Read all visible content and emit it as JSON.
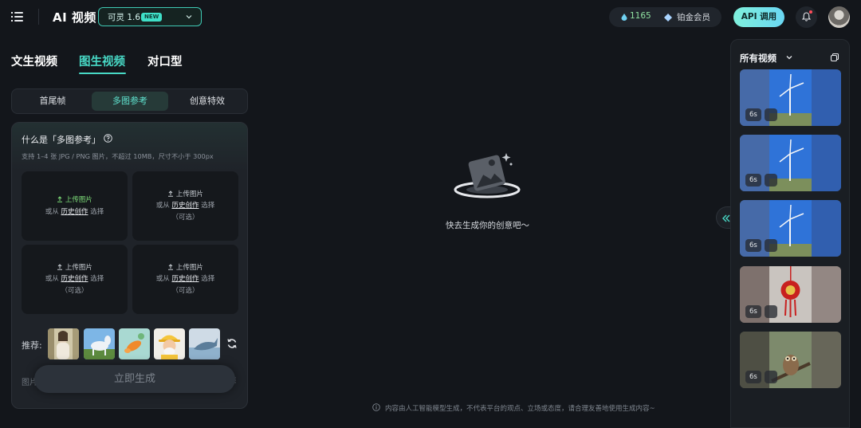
{
  "header": {
    "app_title": "AI 视频",
    "model": {
      "name": "可灵 1.6",
      "badge": "NEW"
    },
    "credits": "1165",
    "membership": "铂金会员",
    "api_label": "API 调用"
  },
  "modes": [
    "文生视频",
    "图生视频",
    "对口型"
  ],
  "active_mode": "图生视频",
  "segments": [
    "首尾帧",
    "多图参考",
    "创意特效"
  ],
  "active_segment": "多图参考",
  "card": {
    "title": "什么是「多图参考」",
    "subtitle": "支持 1–4 张 JPG / PNG 图片，不超过 10MB，尺寸不小于 300px",
    "slots": [
      {
        "upload": "上传图片",
        "or": "或从",
        "history": "历史创作",
        "select": "选择",
        "optional": ""
      },
      {
        "upload": "上传图片",
        "or": "或从",
        "history": "历史创作",
        "select": "选择",
        "optional": "（可选）"
      },
      {
        "upload": "上传图片",
        "or": "或从",
        "history": "历史创作",
        "select": "选择",
        "optional": "（可选）"
      },
      {
        "upload": "上传图片",
        "or": "或从",
        "history": "历史创作",
        "select": "选择",
        "optional": "（可选）"
      }
    ],
    "recommend_label": "推荐:",
    "image_label": "图片",
    "generate_label": "立即生成"
  },
  "center": {
    "empty_text": "快去生成你的创意吧～",
    "disclaimer": "内容由人工智能模型生成，不代表平台的观点、立场或态度，请合理友善地使用生成内容~"
  },
  "videos_panel": {
    "title": "所有视频",
    "items": [
      {
        "duration": "6s",
        "kind": "windmill"
      },
      {
        "duration": "6s",
        "kind": "windmill"
      },
      {
        "duration": "6s",
        "kind": "windmill"
      },
      {
        "duration": "6s",
        "kind": "knot"
      },
      {
        "duration": "6s",
        "kind": "owl"
      }
    ]
  },
  "colors": {
    "accent": "#48d9c6",
    "background": "#13161b",
    "panel": "#1f2329"
  }
}
